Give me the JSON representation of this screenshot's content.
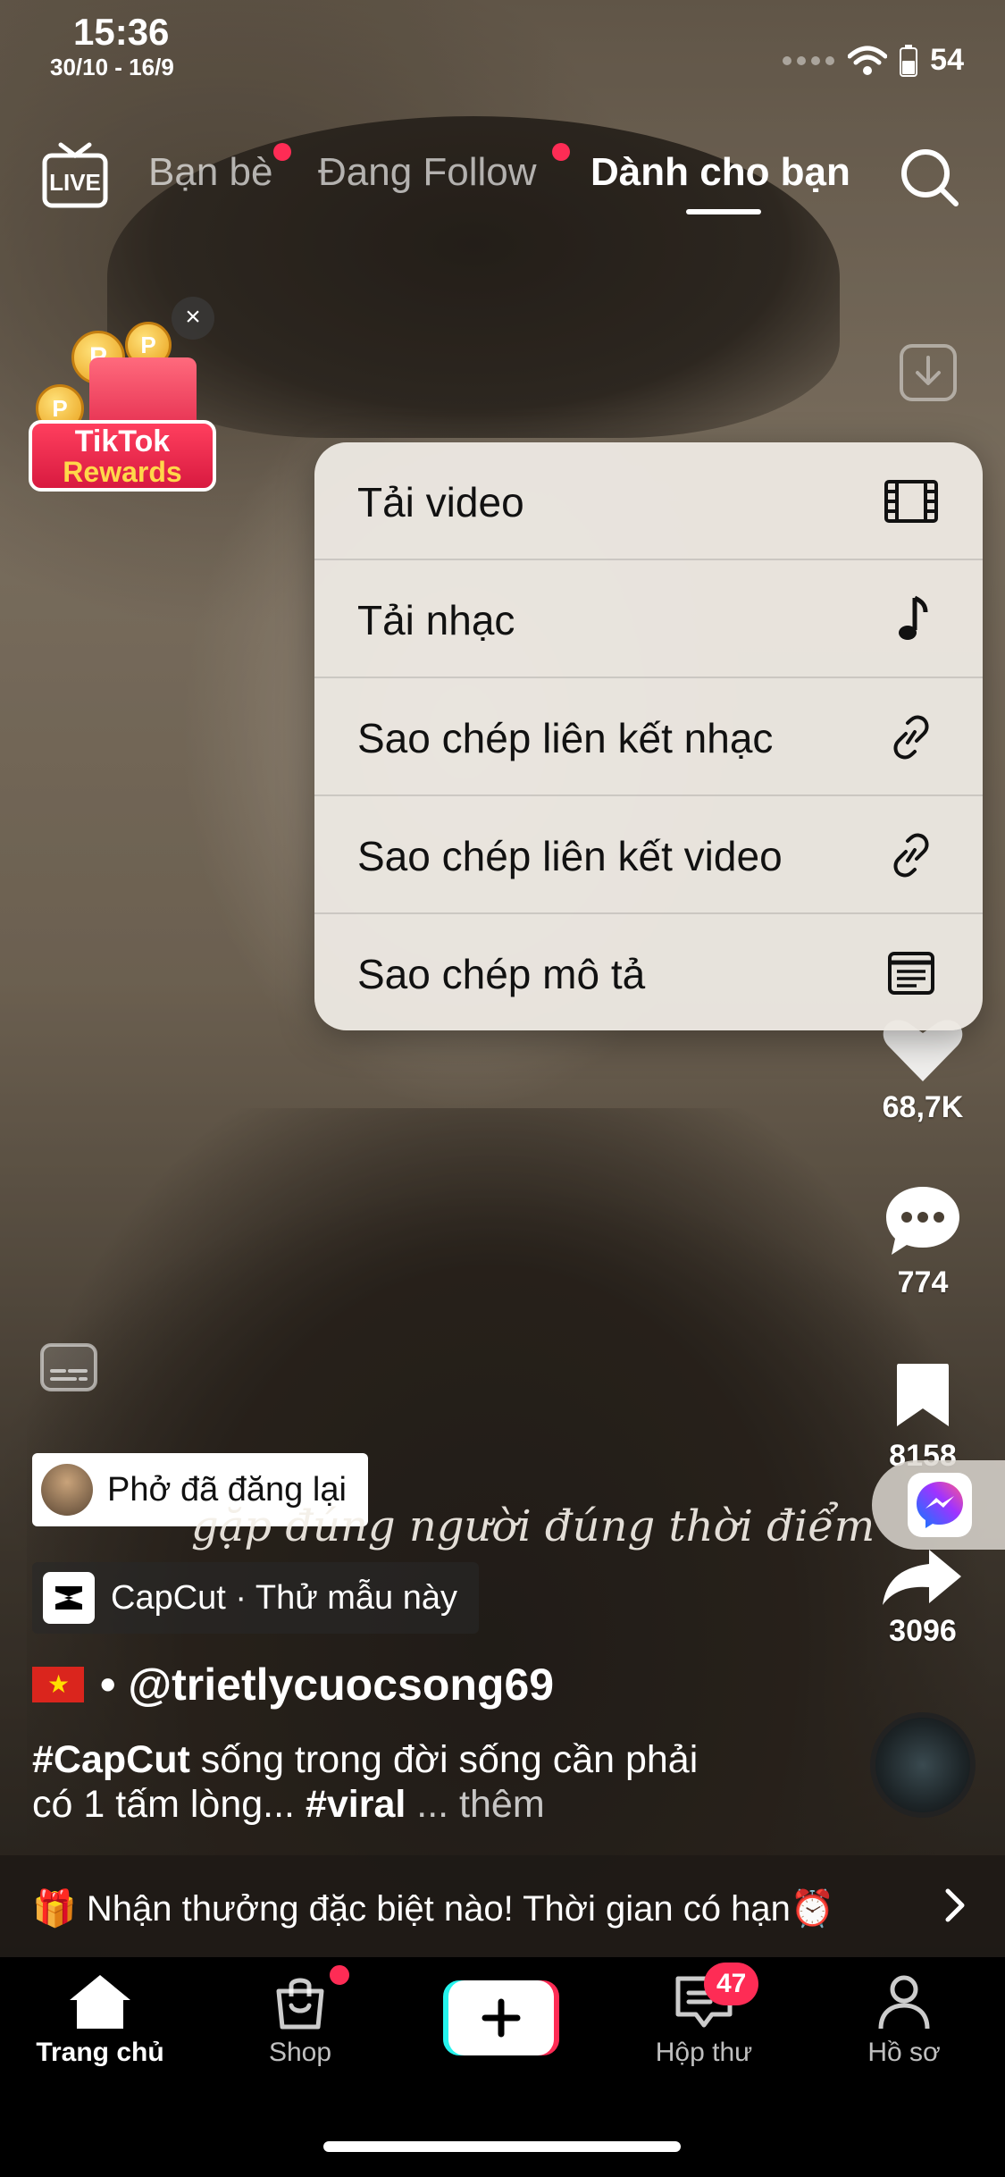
{
  "status_bar": {
    "time": "15:36",
    "date": "30/10 - 16/9",
    "battery": "54"
  },
  "top_nav": {
    "live_label": "LIVE",
    "tabs": [
      {
        "label": "Bạn bè",
        "has_dot": true
      },
      {
        "label": "Đang Follow",
        "has_dot": true
      },
      {
        "label": "Dành cho bạn",
        "active": true
      }
    ]
  },
  "rewards": {
    "line1": "TikTok",
    "line2": "Rewards",
    "close": "×"
  },
  "context_menu": {
    "items": [
      {
        "label": "Tải video",
        "icon": "film-icon"
      },
      {
        "label": "Tải nhạc",
        "icon": "music-note-icon"
      },
      {
        "label": "Sao chép liên kết nhạc",
        "icon": "link-icon"
      },
      {
        "label": "Sao chép liên kết video",
        "icon": "link-icon"
      },
      {
        "label": "Sao chép mô tả",
        "icon": "description-icon"
      }
    ]
  },
  "right_rail": {
    "likes": "68,7K",
    "comments": "774",
    "saves": "8158",
    "shares": "3096"
  },
  "video": {
    "repost_text": "Phở đã đăng lại",
    "overlay_caption": "gặp đúng người đúng thời điểm",
    "capcut_text": "CapCut · Thử mẫu này",
    "username": "• @trietlycuocsong69",
    "description_tag1": "#CapCut",
    "description_text1": " sống trong đời sống cần phải có 1 tấm lòng...",
    "description_tag2": "#viral",
    "description_more": " ... thêm"
  },
  "promo": {
    "text": "🎁 Nhận thưởng đặc biệt nào! Thời gian có hạn⏰"
  },
  "bottom_nav": {
    "items": [
      {
        "label": "Trang chủ",
        "active": true
      },
      {
        "label": "Shop"
      },
      {
        "label": ""
      },
      {
        "label": "Hộp thư",
        "badge": "47"
      },
      {
        "label": "Hồ sơ"
      }
    ]
  },
  "colors": {
    "accent": "#fe2c55",
    "menu_bg": "#ece8e2"
  }
}
